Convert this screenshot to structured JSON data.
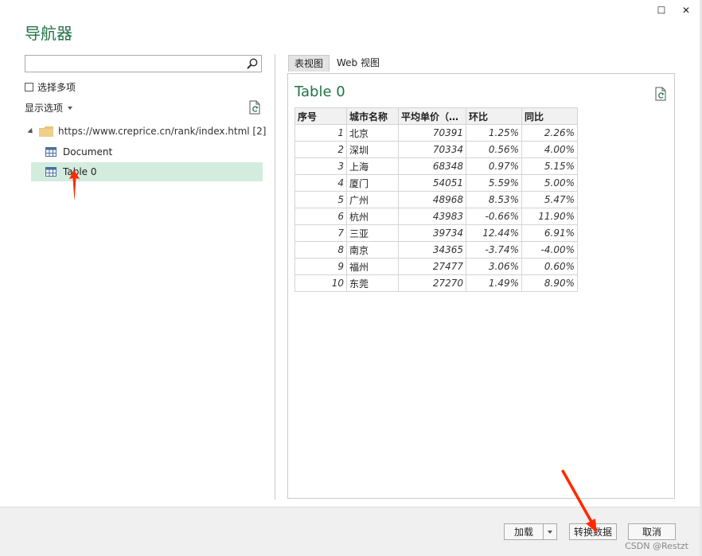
{
  "window": {
    "title": "导航器",
    "maximize_glyph": "☐",
    "close_glyph": "✕"
  },
  "left": {
    "search": {
      "value": "",
      "placeholder": ""
    },
    "select_multiple_label": "选择多项",
    "display_options_label": "显示选项",
    "tree": {
      "root_label": "https://www.creprice.cn/rank/index.html [2]",
      "items": [
        {
          "label": "Document",
          "selected": false
        },
        {
          "label": "Table 0",
          "selected": true
        }
      ]
    }
  },
  "right": {
    "tabs": [
      {
        "label": "表视图",
        "active": true
      },
      {
        "label": "Web 视图",
        "active": false
      }
    ],
    "preview_title": "Table 0",
    "table": {
      "headers": [
        "序号",
        "城市名称",
        "平均单价（…",
        "环比",
        "同比"
      ],
      "rows": [
        [
          "1",
          "北京",
          "70391",
          "1.25%",
          "2.26%"
        ],
        [
          "2",
          "深圳",
          "70334",
          "0.56%",
          "4.00%"
        ],
        [
          "3",
          "上海",
          "68348",
          "0.97%",
          "5.15%"
        ],
        [
          "4",
          "厦门",
          "54051",
          "5.59%",
          "5.00%"
        ],
        [
          "5",
          "广州",
          "48968",
          "8.53%",
          "5.47%"
        ],
        [
          "6",
          "杭州",
          "43983",
          "-0.66%",
          "11.90%"
        ],
        [
          "7",
          "三亚",
          "39734",
          "12.44%",
          "6.91%"
        ],
        [
          "8",
          "南京",
          "34365",
          "-3.74%",
          "-4.00%"
        ],
        [
          "9",
          "福州",
          "27477",
          "3.06%",
          "0.60%"
        ],
        [
          "10",
          "东莞",
          "27270",
          "1.49%",
          "8.90%"
        ]
      ]
    }
  },
  "footer": {
    "load_label": "加载",
    "transform_label": "转换数据",
    "cancel_label": "取消",
    "watermark": "CSDN @Restzt"
  },
  "colors": {
    "accent": "#217346",
    "selection": "#d3ecdd",
    "annotation_arrow": "#ff2a00"
  },
  "icons": [
    "search-icon",
    "refresh-icon",
    "folder-icon",
    "table-icon",
    "chevron-down-icon",
    "maximize-icon",
    "close-icon"
  ]
}
